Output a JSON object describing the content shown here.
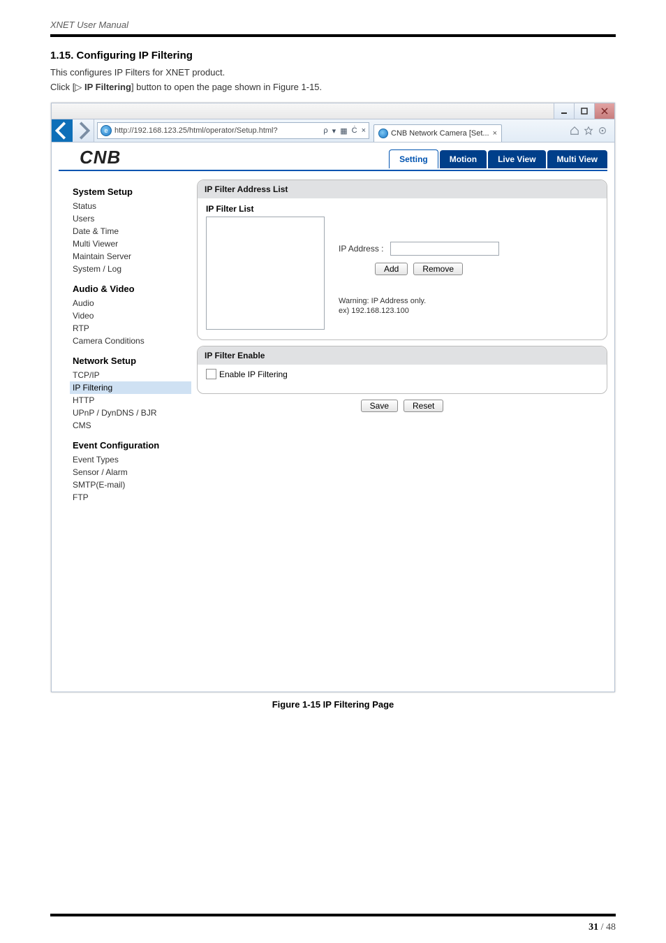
{
  "doc": {
    "header": "XNET User Manual",
    "section_number_title": "1.15. Configuring IP Filtering",
    "intro_line": "This configures IP Filters for XNET product.",
    "click_prefix": "Click [",
    "triangle": "▷",
    "click_bold": " IP Filtering",
    "click_suffix": "] button to open the page shown in Figure 1-15.",
    "figure_caption": "Figure 1-15 IP Filtering Page",
    "page_current": "31",
    "page_sep": " / ",
    "page_total": "48"
  },
  "window": {
    "address": "http://192.168.123.25/html/operator/Setup.html?",
    "addr_tail_1": "ρ",
    "addr_tail_2": "▾",
    "addr_tail_3": "▦",
    "addr_tail_4": "Ċ",
    "addr_tail_5": "×",
    "tab_title": "CNB Network Camera [Set...",
    "tab_close": "×",
    "brand": "CNB",
    "maintabs": {
      "setting": "Setting",
      "motion": "Motion",
      "live_view": "Live View",
      "multi_view": "Multi View"
    }
  },
  "sidebar": {
    "system_setup": "System Setup",
    "system_items": [
      "Status",
      "Users",
      "Date & Time",
      "Multi Viewer",
      "Maintain Server",
      "System / Log"
    ],
    "audio_video": "Audio & Video",
    "av_items": [
      "Audio",
      "Video",
      "RTP",
      "Camera Conditions"
    ],
    "network_setup": "Network Setup",
    "net_items": [
      "TCP/IP",
      "IP Filtering",
      "HTTP",
      "UPnP / DynDNS / BJR",
      "CMS"
    ],
    "net_active_index": 1,
    "event_config": "Event Configuration",
    "event_items": [
      "Event Types",
      "Sensor / Alarm",
      "SMTP(E-mail)",
      "FTP"
    ]
  },
  "panel1": {
    "title": "IP Filter Address List",
    "sub_title": "IP Filter List",
    "ip_label": "IP Address :",
    "ip_value": "",
    "add_btn": "Add",
    "remove_btn": "Remove",
    "warning_l1": "Warning: IP Address only.",
    "warning_l2": "ex) 192.168.123.100"
  },
  "panel2": {
    "title": "IP Filter Enable",
    "checkbox_label": "Enable IP Filtering",
    "save_btn": "Save",
    "reset_btn": "Reset"
  }
}
